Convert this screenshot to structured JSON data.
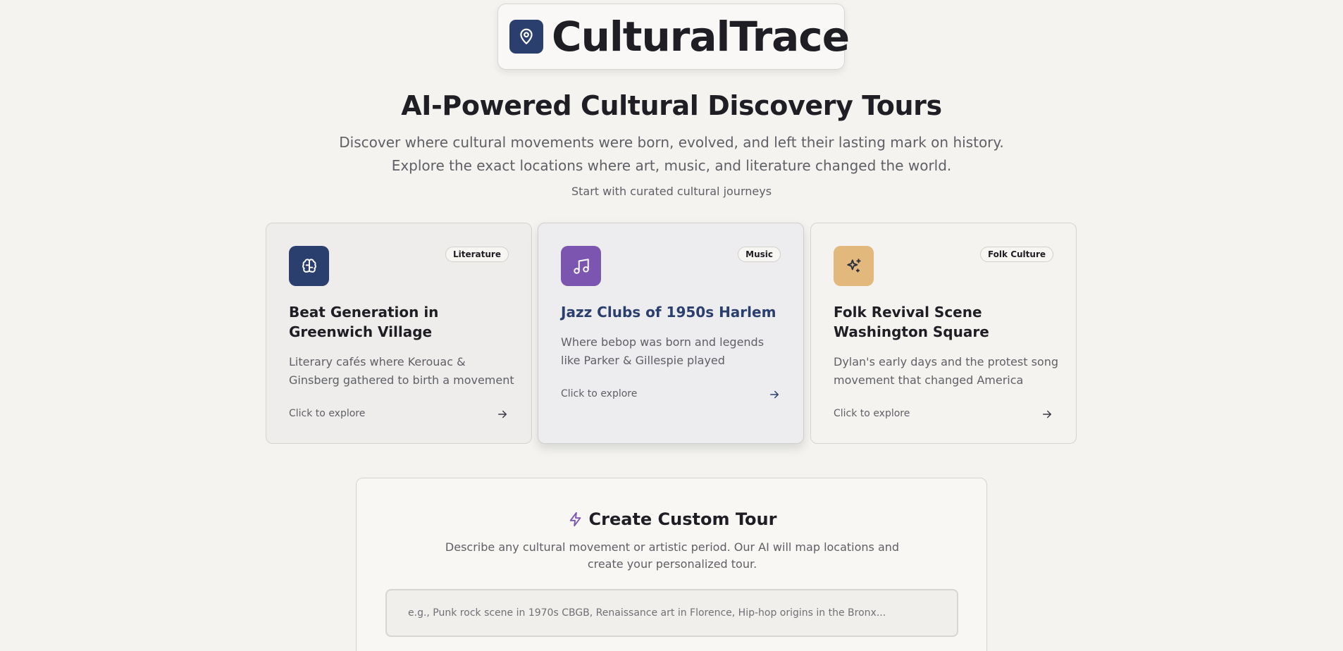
{
  "app": {
    "name": "CulturalTrace"
  },
  "hero": {
    "headline": "AI-Powered Cultural Discovery Tours",
    "subline_1": "Discover where cultural movements were born, evolved, and left their lasting mark on history.",
    "subline_2": "Explore the exact locations where art, music, and literature changed the world.",
    "curated_label": "Start with curated cultural journeys"
  },
  "cards": [
    {
      "badge": "Literature",
      "title": "Beat Generation in Greenwich Village",
      "description": "Literary cafés where Kerouac & Ginsberg gathered to birth a movement",
      "cta": "Click to explore",
      "icon": "brain-icon",
      "icon_bg": "#2b3f6e"
    },
    {
      "badge": "Music",
      "title": "Jazz Clubs of 1950s Harlem",
      "description": "Where bebop was born and legends like Parker & Gillespie played",
      "cta": "Click to explore",
      "icon": "music-note-icon",
      "icon_bg": "#7b55b0"
    },
    {
      "badge": "Folk Culture",
      "title": "Folk Revival Scene Washington Square",
      "description": "Dylan's early days and the protest song movement that changed America",
      "cta": "Click to explore",
      "icon": "sparkles-icon",
      "icon_bg": "#e2b87c"
    }
  ],
  "custom_tour": {
    "title": "Create Custom Tour",
    "description": "Describe any cultural movement or artistic period. Our AI will map locations and create your personalized tour.",
    "input_value": "",
    "input_placeholder": "e.g., Punk rock scene in 1970s CBGB, Renaissance art in Florence, Hip-hop origins in the Bronx...",
    "icon": "lightning-icon"
  },
  "colors": {
    "brand_navy": "#2b3f6e",
    "accent_purple": "#7b55b0",
    "accent_gold": "#e2b87c",
    "background": "#f4f3f0"
  }
}
